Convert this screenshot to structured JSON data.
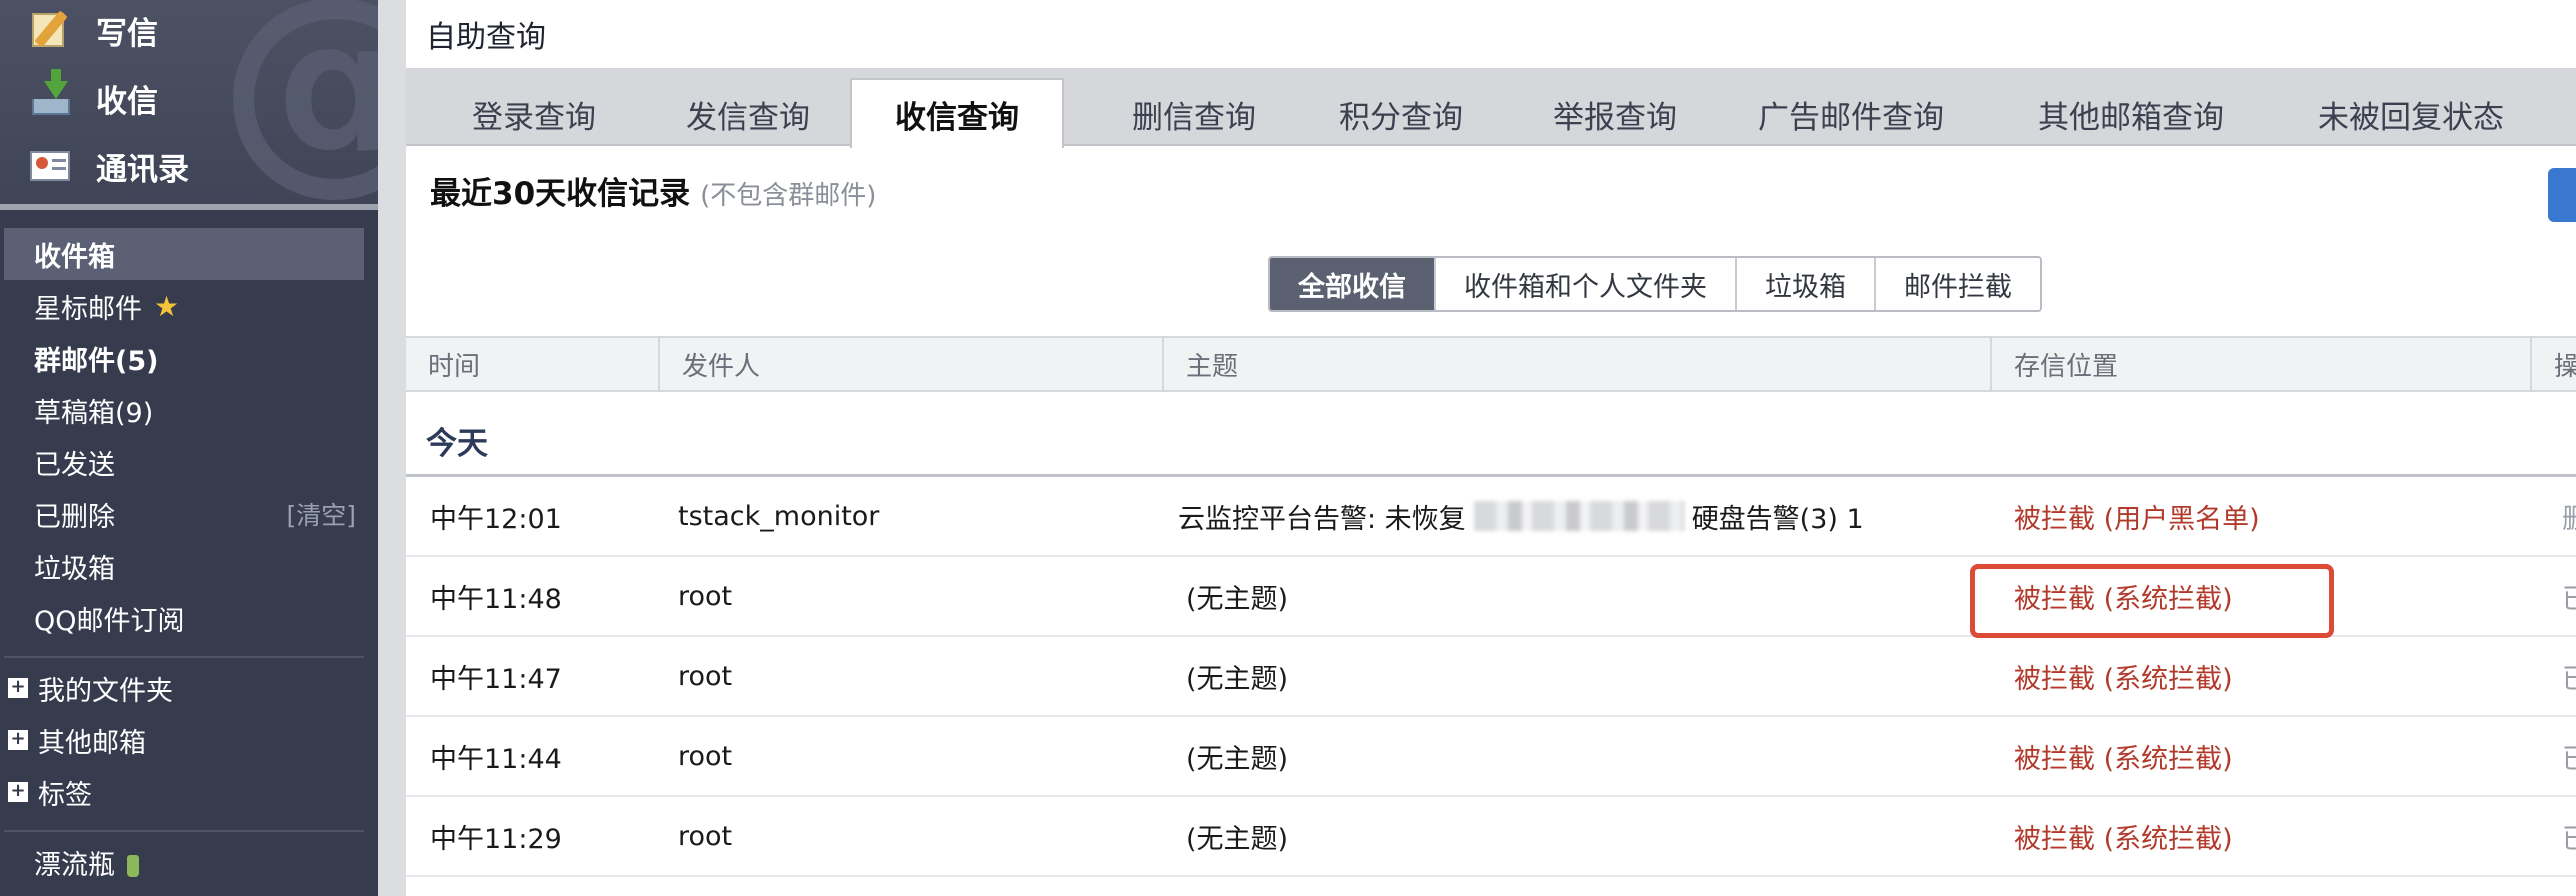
{
  "sidebar": {
    "top_items": [
      {
        "label": "写信",
        "icon": "write-icon"
      },
      {
        "label": "收信",
        "icon": "inbox-download-icon"
      },
      {
        "label": "通讯录",
        "icon": "address-book-icon"
      }
    ],
    "watermark": "@",
    "mailboxes": [
      {
        "label": "收件箱"
      },
      {
        "label": "星标邮件",
        "star": "★"
      },
      {
        "label": "群邮件(5)"
      },
      {
        "label": "草稿箱(9)"
      },
      {
        "label": "已发送"
      },
      {
        "label": "已删除",
        "action": "[清空]"
      },
      {
        "label": "垃圾箱"
      },
      {
        "label": "QQ邮件订阅"
      }
    ],
    "folders": [
      {
        "label": "我的文件夹"
      },
      {
        "label": "其他邮箱"
      },
      {
        "label": "标签"
      }
    ],
    "drift_bottle": "漂流瓶"
  },
  "main": {
    "page_title": "自助查询",
    "tabs": [
      {
        "label": "登录查询"
      },
      {
        "label": "发信查询"
      },
      {
        "label": "收信查询"
      },
      {
        "label": "删信查询"
      },
      {
        "label": "积分查询"
      },
      {
        "label": "举报查询"
      },
      {
        "label": "广告邮件查询"
      },
      {
        "label": "其他邮箱查询"
      },
      {
        "label": "未被回复状态"
      }
    ],
    "active_tab": "收信查询",
    "section_title": "最近30天收信记录",
    "section_note": "(不包含群邮件)",
    "filters": [
      {
        "label": "全部收信"
      },
      {
        "label": "收件箱和个人文件夹"
      },
      {
        "label": "垃圾箱"
      },
      {
        "label": "邮件拦截"
      }
    ],
    "active_filter": "全部收信",
    "columns": [
      "时间",
      "发件人",
      "主题",
      "存信位置",
      "操"
    ],
    "group_label": "今天",
    "rows": [
      {
        "time": "中午12:01",
        "sender": "tstack_monitor",
        "subject_prefix": "云监控平台告警: 未恢复",
        "subject_suffix": "硬盘告警(3) 1",
        "location": "被拦截 (用户黑名单)",
        "op": "删"
      },
      {
        "time": "中午11:48",
        "sender": "root",
        "subject": "(无主题)",
        "location": "被拦截 (系统拦截)",
        "op": "已"
      },
      {
        "time": "中午11:47",
        "sender": "root",
        "subject": "(无主题)",
        "location": "被拦截 (系统拦截)",
        "op": "已"
      },
      {
        "time": "中午11:44",
        "sender": "root",
        "subject": "(无主题)",
        "location": "被拦截 (系统拦截)",
        "op": "已"
      },
      {
        "time": "中午11:29",
        "sender": "root",
        "subject": "(无主题)",
        "location": "被拦截 (系统拦截)",
        "op": "已"
      }
    ],
    "highlight_color": "#dd4a36",
    "blocked_color": "#b23a2a"
  }
}
